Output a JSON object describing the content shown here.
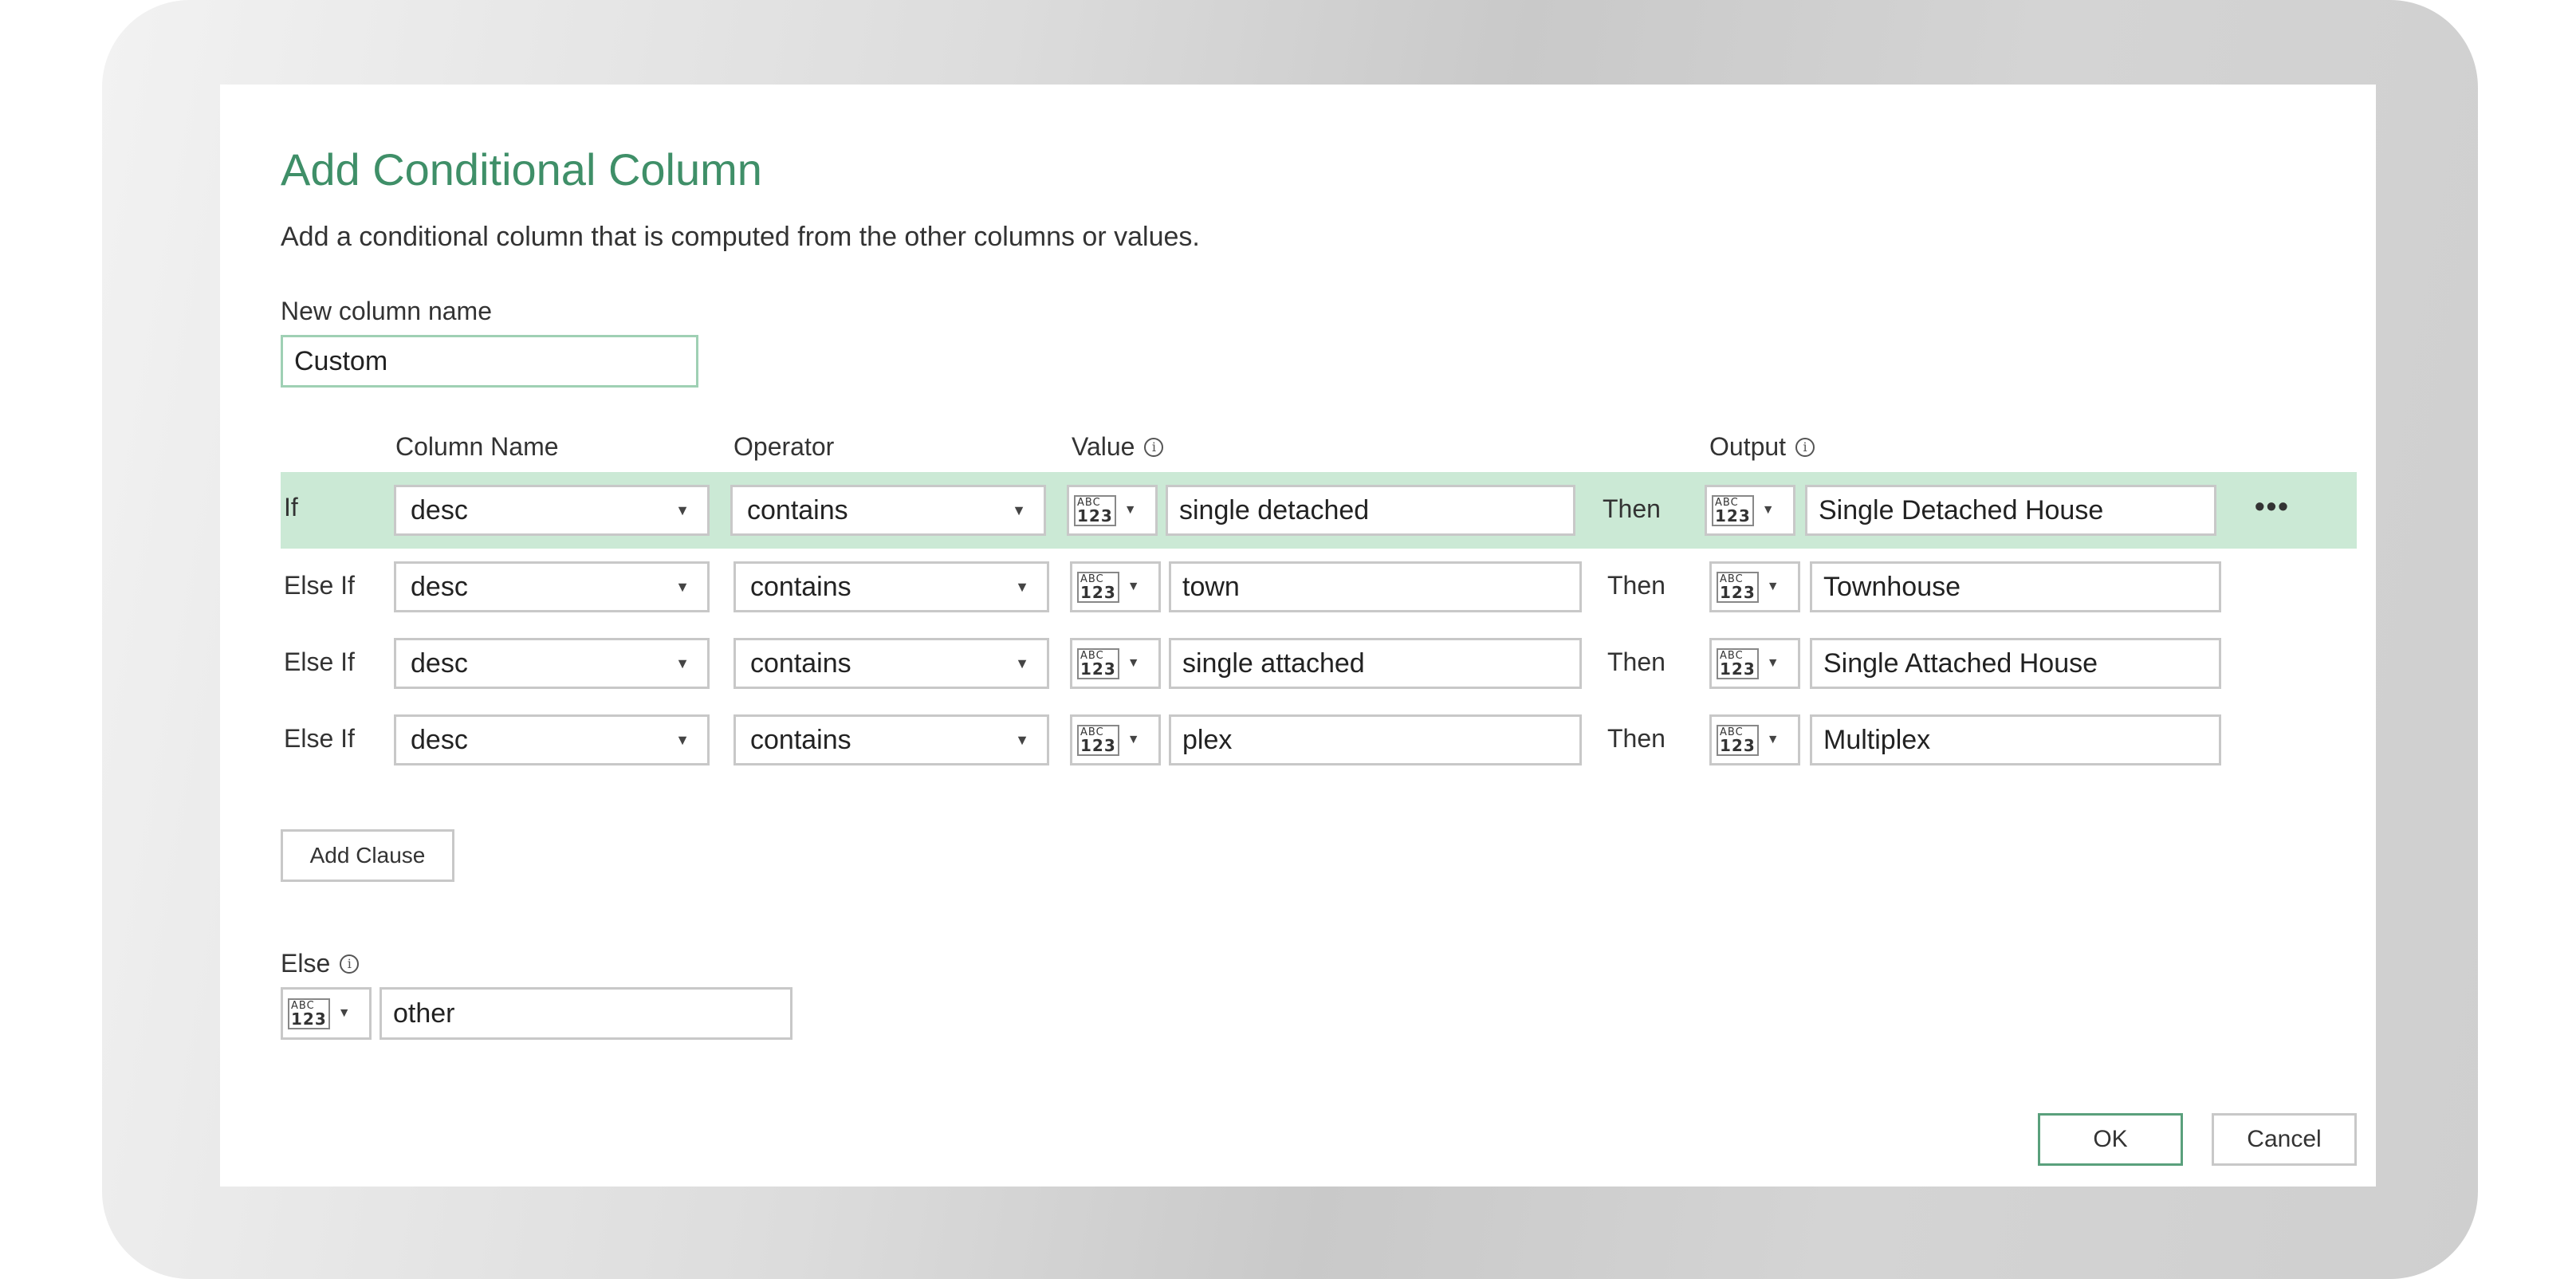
{
  "dialog": {
    "title": "Add Conditional Column",
    "subtitle": "Add a conditional column that is computed from the other columns or values.",
    "new_column_label": "New column name",
    "new_column_value": "Custom"
  },
  "headers": {
    "column_name": "Column Name",
    "operator": "Operator",
    "value": "Value",
    "output": "Output"
  },
  "type_glyph": {
    "top": "ABC",
    "bottom": "123"
  },
  "icons": {
    "info": "info-circle-icon",
    "dropdown": "chevron-down-icon",
    "more": "more-options-icon"
  },
  "rows": [
    {
      "label": "If",
      "column": "desc",
      "operator": "contains",
      "value": "single detached",
      "then": "Then",
      "output": "Single Detached House"
    },
    {
      "label": "Else If",
      "column": "desc",
      "operator": "contains",
      "value": "town",
      "then": "Then",
      "output": "Townhouse"
    },
    {
      "label": "Else If",
      "column": "desc",
      "operator": "contains",
      "value": "single attached",
      "then": "Then",
      "output": "Single Attached House"
    },
    {
      "label": "Else If",
      "column": "desc",
      "operator": "contains",
      "value": "plex",
      "then": "Then",
      "output": "Multiplex"
    }
  ],
  "more_options": "•••",
  "add_clause_label": "Add Clause",
  "else": {
    "label": "Else",
    "value": "other"
  },
  "buttons": {
    "ok": "OK",
    "cancel": "Cancel"
  },
  "colors": {
    "accent": "#3f8f68",
    "row_highlight": "#cbe9d5",
    "ok_border": "#5aa07c"
  }
}
